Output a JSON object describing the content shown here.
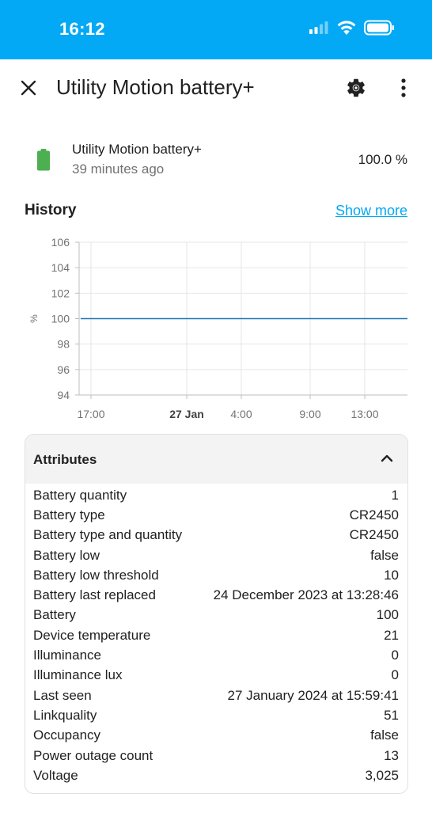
{
  "status_bar": {
    "time": "16:12",
    "color": "#03a9f4"
  },
  "toolbar": {
    "title": "Utility Motion battery+",
    "close_icon": "close-icon",
    "settings_icon": "gear-icon",
    "menu_icon": "more-vert-icon"
  },
  "entity": {
    "name": "Utility Motion battery+",
    "last_changed": "39 minutes ago",
    "state": "100.0 %",
    "icon": "battery-full-icon",
    "icon_color": "#4caf50"
  },
  "history": {
    "title": "History",
    "show_more": "Show more"
  },
  "chart_data": {
    "type": "line",
    "title": "",
    "xlabel": "",
    "ylabel": "%",
    "ylim": [
      94,
      106
    ],
    "y_ticks": [
      "106",
      "104",
      "102",
      "100",
      "98",
      "96",
      "94"
    ],
    "x_ticks": [
      {
        "label": "17:00",
        "bold": false
      },
      {
        "label": "27 Jan",
        "bold": true
      },
      {
        "label": "4:00",
        "bold": false
      },
      {
        "label": "9:00",
        "bold": false
      },
      {
        "label": "13:00",
        "bold": false
      }
    ],
    "series": [
      {
        "values": [
          100,
          100
        ],
        "color": "#1f77b4"
      }
    ],
    "grid": true
  },
  "attributes": {
    "header": "Attributes",
    "rows": [
      {
        "label": "Battery quantity",
        "value": "1"
      },
      {
        "label": "Battery type",
        "value": "CR2450"
      },
      {
        "label": "Battery type and quantity",
        "value": "CR2450"
      },
      {
        "label": "Battery low",
        "value": "false"
      },
      {
        "label": "Battery low threshold",
        "value": "10"
      },
      {
        "label": "Battery last replaced",
        "value": "24 December 2023 at 13:28:46"
      },
      {
        "label": "Battery",
        "value": "100"
      },
      {
        "label": "Device temperature",
        "value": "21"
      },
      {
        "label": "Illuminance",
        "value": "0"
      },
      {
        "label": "Illuminance lux",
        "value": "0"
      },
      {
        "label": "Last seen",
        "value": "27 January 2024 at 15:59:41"
      },
      {
        "label": "Linkquality",
        "value": "51"
      },
      {
        "label": "Occupancy",
        "value": "false"
      },
      {
        "label": "Power outage count",
        "value": "13"
      },
      {
        "label": "Voltage",
        "value": "3,025"
      }
    ]
  }
}
